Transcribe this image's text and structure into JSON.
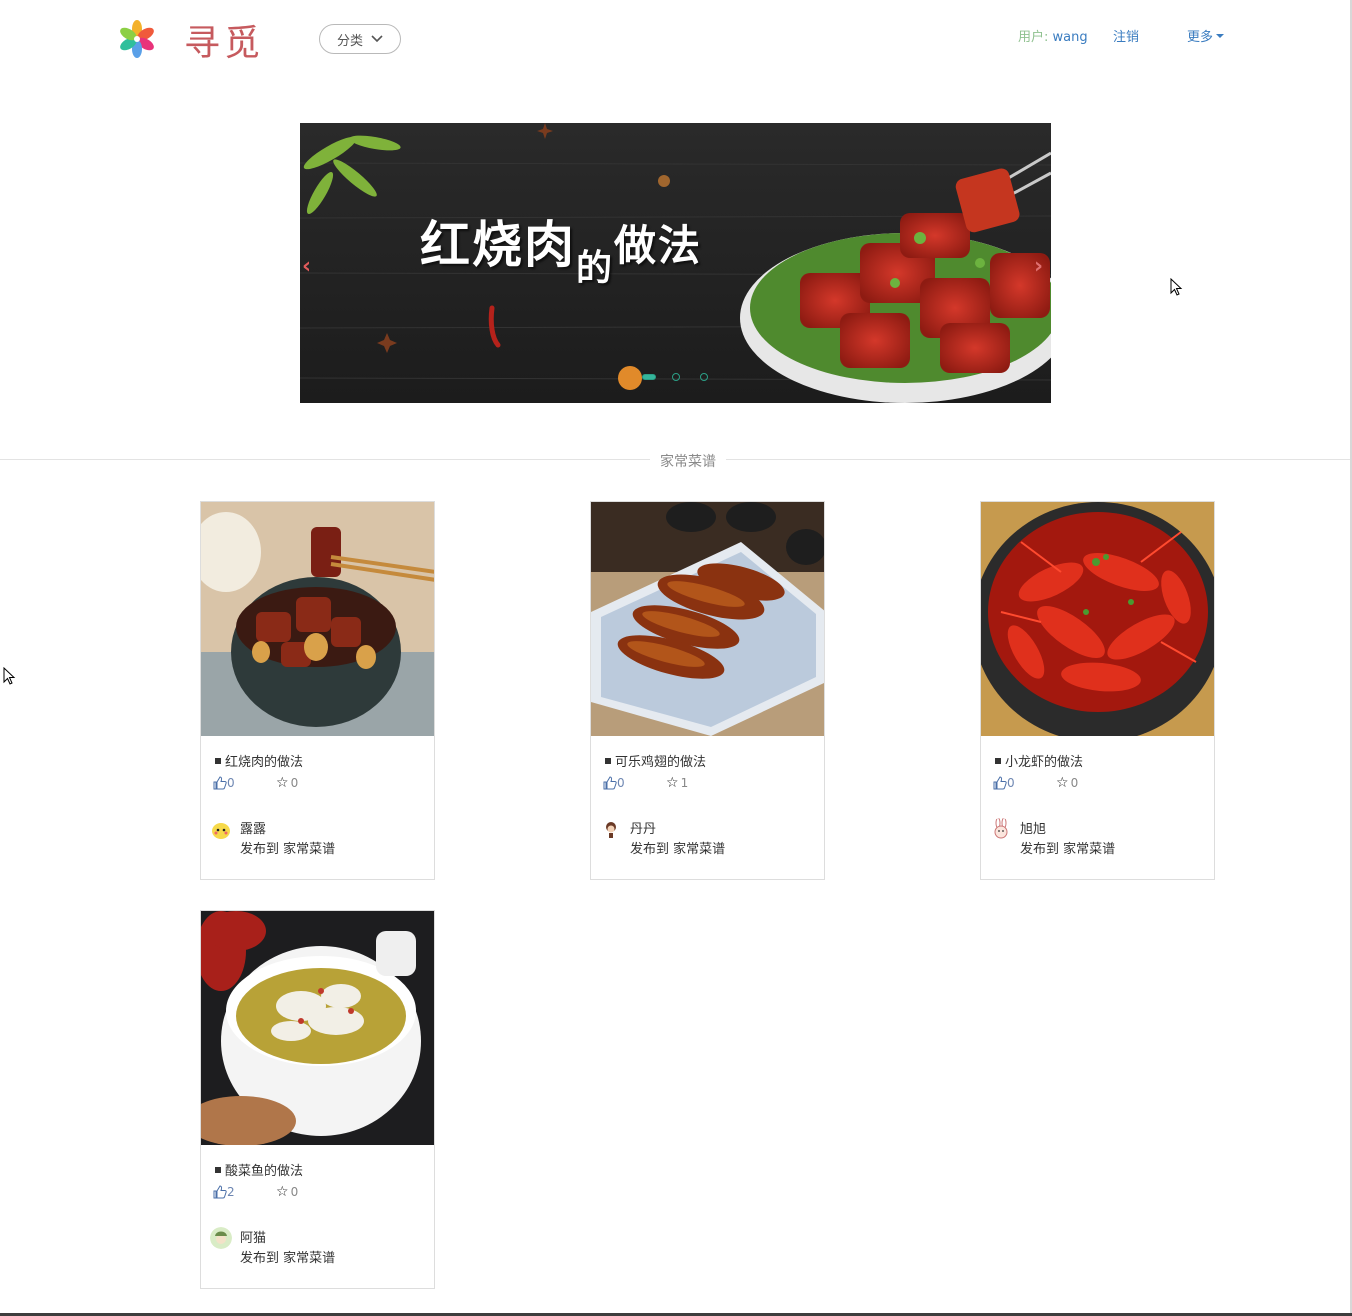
{
  "header": {
    "brand": "寻觅",
    "category_button": "分类",
    "user_label": "用户: ",
    "user_name": "wang",
    "logout": "注销",
    "more": "更多"
  },
  "banner": {
    "title_main": "红烧肉",
    "title_small": "的",
    "title_rest": "做法",
    "prev_icon": "‹",
    "next_icon": "›",
    "slide_count": 3,
    "active_slide": 1
  },
  "section": {
    "label": "家常菜谱"
  },
  "recipes": [
    {
      "title": "红烧肉的做法",
      "likes": "0",
      "favorites": "0",
      "author": "露露",
      "published_to": "发布到 家常菜谱"
    },
    {
      "title": "可乐鸡翅的做法",
      "likes": "0",
      "favorites": "1",
      "author": "丹丹",
      "published_to": "发布到 家常菜谱"
    },
    {
      "title": "小龙虾的做法",
      "likes": "0",
      "favorites": "0",
      "author": "旭旭",
      "published_to": "发布到 家常菜谱"
    },
    {
      "title": "酸菜鱼的做法",
      "likes": "2",
      "favorites": "0",
      "author": "阿猫",
      "published_to": "发布到 家常菜谱"
    }
  ],
  "colors": {
    "brand": "#c65a5e",
    "link": "#3a7cc0",
    "user_label": "#8fc18f",
    "carousel_dot": "#35b59b"
  }
}
